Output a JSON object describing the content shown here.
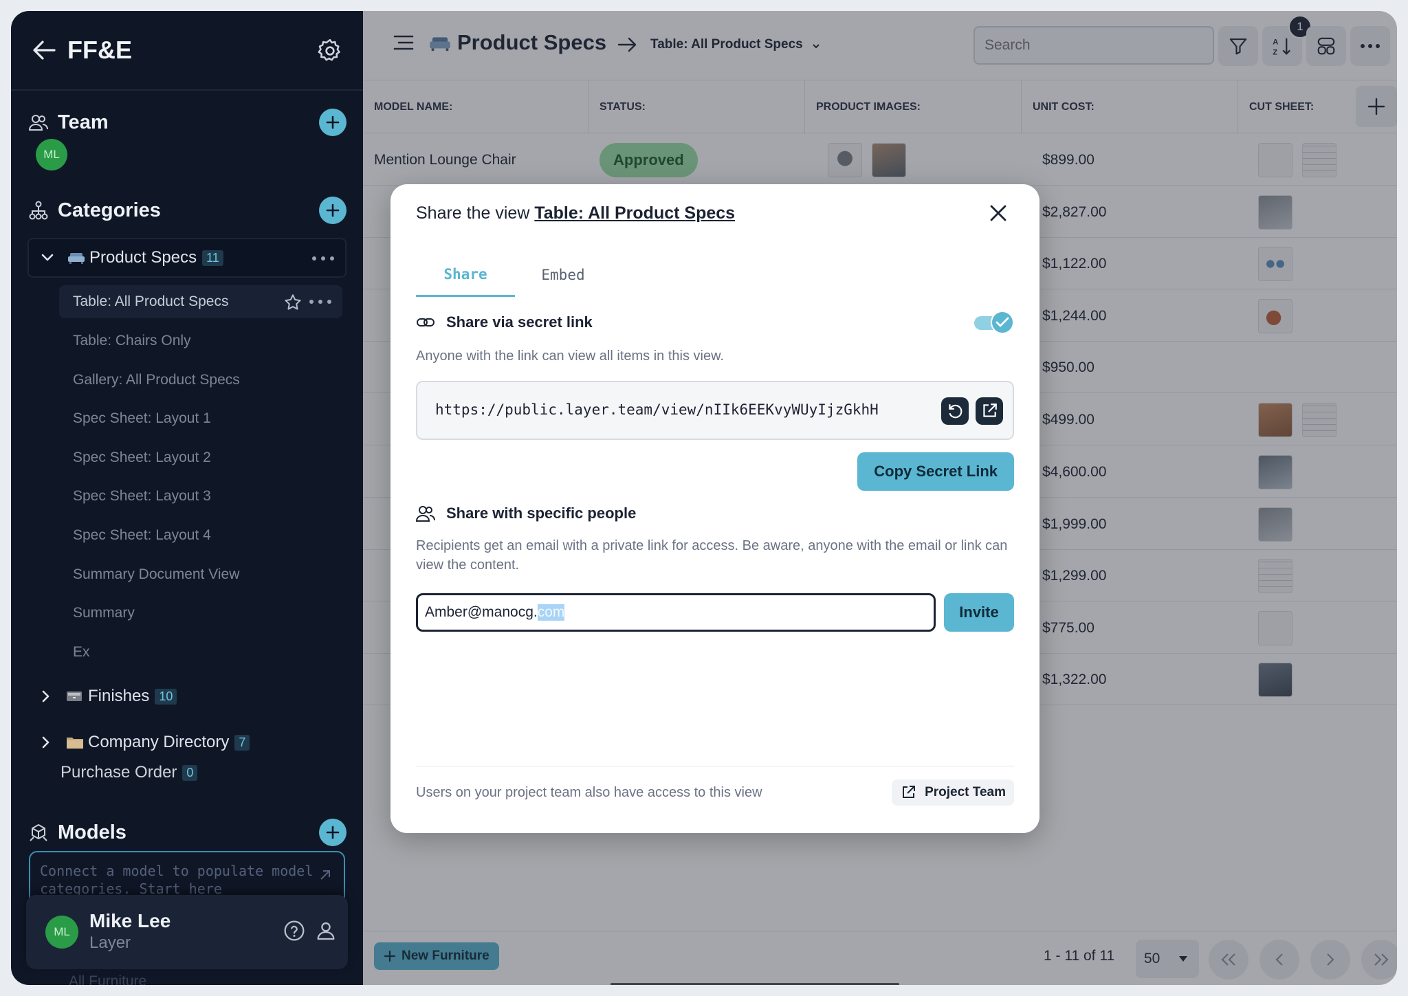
{
  "sidebar": {
    "title": "FF&E",
    "team_label": "Team",
    "team_avatar": "ML",
    "categories_label": "Categories",
    "categories": [
      {
        "label": "Product Specs",
        "count": "11",
        "icon": "sofa-emoji"
      },
      {
        "label": "Finishes",
        "count": "10",
        "icon": "drawer-emoji"
      },
      {
        "label": "Company Directory",
        "count": "7",
        "icon": "folder-emoji"
      }
    ],
    "views": [
      "Table: All Product Specs",
      "Table: Chairs Only",
      "Gallery: All Product Specs",
      "Spec Sheet: Layout 1",
      "Spec Sheet: Layout 2",
      "Spec Sheet: Layout 3",
      "Spec Sheet: Layout 4",
      "Summary Document View",
      "Summary",
      "Ex"
    ],
    "purchase_order": {
      "label": "Purchase Order",
      "count": "0"
    },
    "models_label": "Models",
    "model_placeholder": "Connect a model to populate model categories. Start here",
    "user": {
      "initials": "ML",
      "name": "Mike Lee",
      "org": "Layer"
    },
    "faded_item": "All Furniture"
  },
  "topbar": {
    "title": "Product Specs",
    "view": "Table: All Product Specs",
    "search_placeholder": "Search",
    "sort_badge": "1"
  },
  "table": {
    "columns": [
      "MODEL NAME:",
      "STATUS:",
      "PRODUCT IMAGES:",
      "UNIT COST:",
      "CUT SHEET:"
    ],
    "rows": [
      {
        "model": "Mention Lounge Chair",
        "status": "Approved",
        "cost": "$899.00"
      },
      {
        "cost": "$2,827.00"
      },
      {
        "cost": "$1,122.00"
      },
      {
        "cost": "$1,244.00"
      },
      {
        "cost": "$950.00"
      },
      {
        "cost": "$499.00"
      },
      {
        "cost": "$4,600.00"
      },
      {
        "cost": "$1,999.00"
      },
      {
        "cost": "$1,299.00"
      },
      {
        "cost": "$775.00"
      },
      {
        "cost": "$1,322.00"
      }
    ]
  },
  "footer": {
    "new_button": "New Furniture",
    "pagination": "1 - 11 of 11",
    "per_page": "50"
  },
  "modal": {
    "title_prefix": "Share the view",
    "title_link": "Table: All Product Specs",
    "tabs": [
      "Share",
      "Embed"
    ],
    "secret_link_label": "Share via secret link",
    "secret_link_enabled": true,
    "secret_link_desc": "Anyone with the link can view all items in this view.",
    "secret_url": "https://public.layer.team/view/nIIk6EEKvyWUyIjzGkhH",
    "copy_button": "Copy Secret Link",
    "people_label": "Share with specific people",
    "people_desc": "Recipients get an email with a private link for access. Be aware, anyone with the email or link can view the content.",
    "email_value_main": "Amber@manocg.",
    "email_value_selected": "com",
    "invite_button": "Invite",
    "footer_text": "Users on your project team also have access to this view",
    "project_team_button": "Project Team"
  },
  "colors": {
    "accent": "#5bb6d1",
    "sidebar_bg": "#0f1727",
    "status_approved": "#9be0a6"
  }
}
